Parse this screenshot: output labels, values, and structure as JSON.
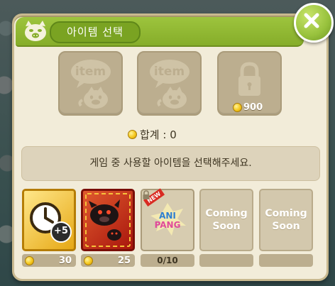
{
  "popup": {
    "title": "아이템 선택"
  },
  "top_slots": [
    {
      "label": "item",
      "locked": false
    },
    {
      "label": "item",
      "locked": false
    },
    {
      "label": "",
      "locked": true,
      "price": "900"
    }
  ],
  "total": {
    "label": "합계 : 0"
  },
  "instruction": "게임 중 사용할 아이템을 선택해주세요.",
  "items": [
    {
      "icon": "clock-plus-five-icon",
      "badge": "+5",
      "price": "30"
    },
    {
      "icon": "black-pig-icon",
      "price": "25"
    },
    {
      "icon": "anipang-icon",
      "new_badge": "NEW",
      "word_top": "ANI",
      "word_bottom": "PANG",
      "count": "0/10",
      "locked": true
    },
    {
      "label_line1": "Coming",
      "label_line2": "Soon"
    },
    {
      "label_line1": "Coming",
      "label_line2": "Soon"
    }
  ],
  "colors": {
    "header_green": "#8db834",
    "panel_bg": "#f2ecd9",
    "slot_bg": "#bcae8f",
    "coin_gold": "#f5c71b"
  }
}
